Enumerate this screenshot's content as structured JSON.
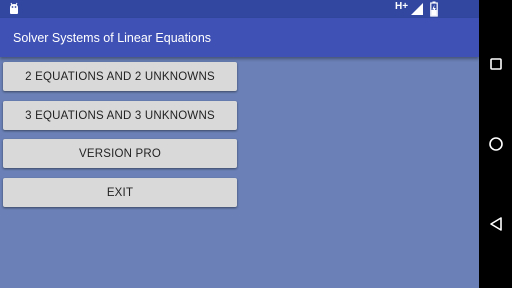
{
  "app": {
    "title": "Solver Systems of Linear Equations"
  },
  "status_bar": {
    "network_type": "H+",
    "icons": [
      "android-debug-icon",
      "signal-icon",
      "battery-charging-icon"
    ]
  },
  "menu": {
    "buttons": [
      {
        "label": "2 EQUATIONS AND 2 UNKNOWNS"
      },
      {
        "label": "3 EQUATIONS AND 3 UNKNOWNS"
      },
      {
        "label": "VERSION PRO"
      },
      {
        "label": "EXIT"
      }
    ]
  },
  "nav_bar": {
    "icons": [
      "recent-apps-icon",
      "home-icon",
      "back-icon"
    ]
  },
  "colors": {
    "status_bar": "#3248a0",
    "app_bar": "#3f51b5",
    "background": "#6a80b6",
    "button": "#d9d9d9",
    "nav_bar": "#000000"
  }
}
